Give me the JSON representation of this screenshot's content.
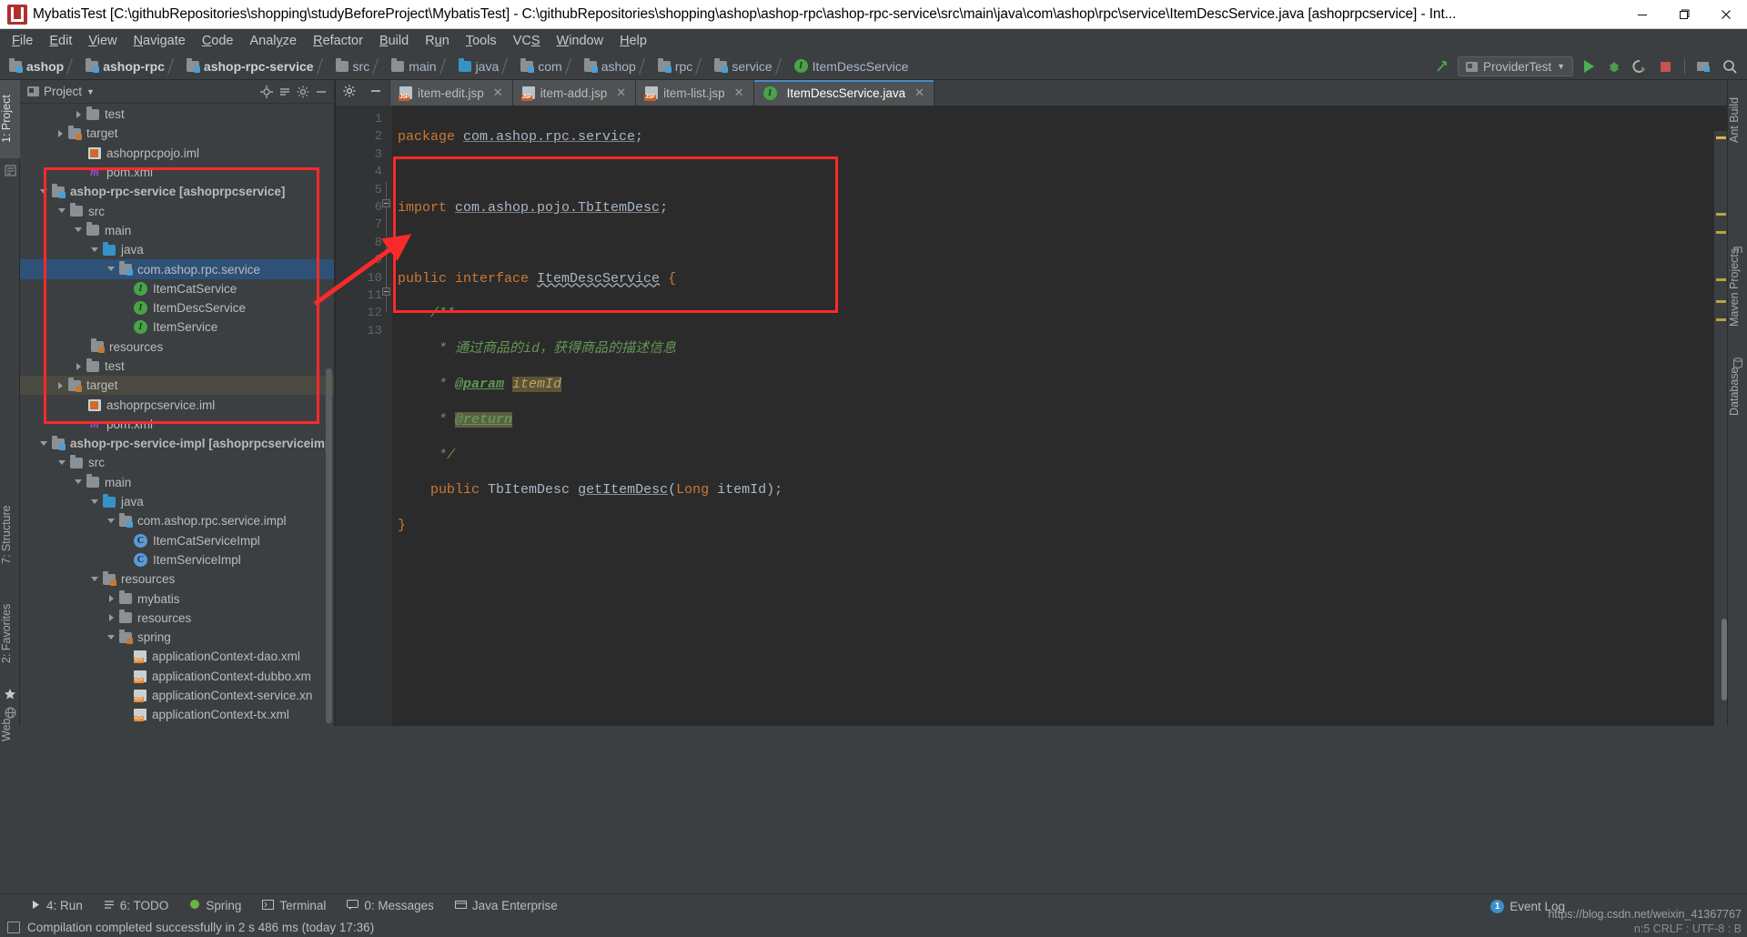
{
  "window": {
    "title": "MybatisTest [C:\\githubRepositories\\shopping\\studyBeforeProject\\MybatisTest] - C:\\githubRepositories\\shopping\\ashop\\ashop-rpc\\ashop-rpc-service\\src\\main\\java\\com\\ashop\\rpc\\service\\ItemDescService.java [ashoprpcservice] - Int...",
    "minimize": "—",
    "maximize": "❐",
    "close": "✕"
  },
  "menu": [
    {
      "label": "File"
    },
    {
      "label": "Edit"
    },
    {
      "label": "View"
    },
    {
      "label": "Navigate"
    },
    {
      "label": "Code"
    },
    {
      "label": "Analyze"
    },
    {
      "label": "Refactor"
    },
    {
      "label": "Build"
    },
    {
      "label": "Run"
    },
    {
      "label": "Tools"
    },
    {
      "label": "VCS"
    },
    {
      "label": "Window"
    },
    {
      "label": "Help"
    }
  ],
  "breadcrumb": [
    {
      "label": "ashop",
      "icon": "module-folder-icon",
      "bold": true
    },
    {
      "label": "ashop-rpc",
      "icon": "module-folder-icon",
      "bold": true
    },
    {
      "label": "ashop-rpc-service",
      "icon": "module-folder-icon",
      "bold": true
    },
    {
      "label": "src",
      "icon": "folder-icon",
      "bold": false
    },
    {
      "label": "main",
      "icon": "folder-icon",
      "bold": false
    },
    {
      "label": "java",
      "icon": "source-folder-icon",
      "bold": false
    },
    {
      "label": "com",
      "icon": "package-icon",
      "bold": false
    },
    {
      "label": "ashop",
      "icon": "package-icon",
      "bold": false
    },
    {
      "label": "rpc",
      "icon": "package-icon",
      "bold": false
    },
    {
      "label": "service",
      "icon": "package-icon",
      "bold": false
    },
    {
      "label": "ItemDescService",
      "icon": "interface-icon",
      "bold": false
    }
  ],
  "toolbar_right": {
    "run_config": "ProviderTest",
    "icons": [
      "build-icon",
      "run-icon",
      "debug-icon",
      "coverage-icon",
      "stop-icon",
      "project-structure-icon",
      "search-icon"
    ]
  },
  "project_panel": {
    "title": "Project",
    "header_icons": [
      "locate-icon",
      "collapse-all-icon",
      "settings-icon",
      "hide-icon"
    ],
    "tree": [
      {
        "label": "test",
        "indent": 3,
        "icon": "folder",
        "arrow": "closed"
      },
      {
        "label": "target",
        "indent": 2,
        "icon": "folder-orange",
        "arrow": "closed"
      },
      {
        "label": "ashoprpcpojo.iml",
        "indent": 3,
        "icon": "iml",
        "arrow": "none"
      },
      {
        "label": "pom.xml",
        "indent": 3,
        "icon": "maven",
        "arrow": "none"
      },
      {
        "label": "ashop-rpc-service [ashoprpcservice]",
        "indent": 1,
        "icon": "module",
        "arrow": "open",
        "bold": true
      },
      {
        "label": "src",
        "indent": 2,
        "icon": "folder",
        "arrow": "open"
      },
      {
        "label": "main",
        "indent": 3,
        "icon": "folder",
        "arrow": "open"
      },
      {
        "label": "java",
        "indent": 4,
        "icon": "source-folder",
        "arrow": "open"
      },
      {
        "label": "com.ashop.rpc.service",
        "indent": 5,
        "icon": "package",
        "arrow": "open",
        "selected": true
      },
      {
        "label": "ItemCatService",
        "indent": 6,
        "icon": "interface",
        "arrow": "none"
      },
      {
        "label": "ItemDescService",
        "indent": 6,
        "icon": "interface",
        "arrow": "none"
      },
      {
        "label": "ItemService",
        "indent": 6,
        "icon": "interface",
        "arrow": "none"
      },
      {
        "label": "resources",
        "indent": 4,
        "icon": "resources-folder",
        "arrow": "none"
      },
      {
        "label": "test",
        "indent": 3,
        "icon": "folder",
        "arrow": "closed"
      },
      {
        "label": "target",
        "indent": 2,
        "icon": "folder-orange",
        "arrow": "closed",
        "highlight": true
      },
      {
        "label": "ashoprpcservice.iml",
        "indent": 3,
        "icon": "iml",
        "arrow": "none"
      },
      {
        "label": "pom.xml",
        "indent": 3,
        "icon": "maven",
        "arrow": "none"
      },
      {
        "label": "ashop-rpc-service-impl [ashoprpcserviceimp",
        "indent": 1,
        "icon": "module",
        "arrow": "open",
        "bold": true
      },
      {
        "label": "src",
        "indent": 2,
        "icon": "folder",
        "arrow": "open"
      },
      {
        "label": "main",
        "indent": 3,
        "icon": "folder",
        "arrow": "open"
      },
      {
        "label": "java",
        "indent": 4,
        "icon": "source-folder",
        "arrow": "open"
      },
      {
        "label": "com.ashop.rpc.service.impl",
        "indent": 5,
        "icon": "package",
        "arrow": "open"
      },
      {
        "label": "ItemCatServiceImpl",
        "indent": 6,
        "icon": "class",
        "arrow": "none"
      },
      {
        "label": "ItemServiceImpl",
        "indent": 6,
        "icon": "class",
        "arrow": "none"
      },
      {
        "label": "resources",
        "indent": 4,
        "icon": "resources-folder",
        "arrow": "open"
      },
      {
        "label": "mybatis",
        "indent": 5,
        "icon": "folder",
        "arrow": "closed"
      },
      {
        "label": "resources",
        "indent": 5,
        "icon": "folder",
        "arrow": "closed"
      },
      {
        "label": "spring",
        "indent": 5,
        "icon": "resources-folder",
        "arrow": "open"
      },
      {
        "label": "applicationContext-dao.xml",
        "indent": 6,
        "icon": "xml",
        "arrow": "none"
      },
      {
        "label": "applicationContext-dubbo.xm",
        "indent": 6,
        "icon": "xml",
        "arrow": "none"
      },
      {
        "label": "applicationContext-service.xn",
        "indent": 6,
        "icon": "xml",
        "arrow": "none"
      },
      {
        "label": "applicationContext-tx.xml",
        "indent": 6,
        "icon": "xml",
        "arrow": "none"
      }
    ]
  },
  "left_strip": [
    {
      "label": "1: Project",
      "selected": true
    },
    {
      "label": "7: Structure",
      "selected": false
    },
    {
      "label": "2: Favorites",
      "selected": false
    },
    {
      "label": "Web",
      "selected": false
    }
  ],
  "right_strip": [
    {
      "label": "Ant Build"
    },
    {
      "label": "Maven Projects"
    },
    {
      "label": "Database"
    }
  ],
  "editor": {
    "tabs": [
      {
        "label": "item-edit.jsp",
        "icon": "jsp-file-icon",
        "active": false
      },
      {
        "label": "item-add.jsp",
        "icon": "jsp-file-icon",
        "active": false
      },
      {
        "label": "item-list.jsp",
        "icon": "jsp-file-icon",
        "active": false
      },
      {
        "label": "ItemDescService.java",
        "icon": "interface-icon",
        "active": true
      }
    ],
    "close_glyph": "✕",
    "line_numbers": [
      "1",
      "2",
      "3",
      "4",
      "5",
      "6",
      "7",
      "8",
      "9",
      "10",
      "11",
      "12",
      "13"
    ],
    "lines": [
      {
        "n": 1,
        "tokens": [
          {
            "t": "package ",
            "c": "kw"
          },
          {
            "t": "com.ashop.rpc.service",
            "c": "cls"
          },
          {
            "t": ";",
            "c": "plain"
          }
        ]
      },
      {
        "n": 2,
        "tokens": []
      },
      {
        "n": 3,
        "tokens": [
          {
            "t": "import ",
            "c": "kw"
          },
          {
            "t": "com.ashop.pojo.TbItemDesc",
            "c": "cls"
          },
          {
            "t": ";",
            "c": "plain"
          }
        ]
      },
      {
        "n": 4,
        "tokens": []
      },
      {
        "n": 5,
        "tokens": [
          {
            "t": "public ",
            "c": "kw"
          },
          {
            "t": "interface ",
            "c": "kw"
          },
          {
            "t": "ItemDescService",
            "c": "wavy"
          },
          {
            "t": " {",
            "c": "brace"
          }
        ]
      },
      {
        "n": 6,
        "tokens": [
          {
            "t": "    /**",
            "c": "cmt"
          }
        ]
      },
      {
        "n": 7,
        "tokens": [
          {
            "t": "     * ",
            "c": "cmt"
          },
          {
            "t": "通过商品的id，获得商品的描述信息",
            "c": "cmt"
          }
        ]
      },
      {
        "n": 8,
        "tokens": [
          {
            "t": "     * ",
            "c": "cmt"
          },
          {
            "t": "@param",
            "c": "tag"
          },
          {
            "t": " ",
            "c": "cmt"
          },
          {
            "t": "itemId",
            "c": "prm"
          }
        ]
      },
      {
        "n": 9,
        "tokens": [
          {
            "t": "     * ",
            "c": "cmt"
          },
          {
            "t": "@return",
            "c": "tagh"
          }
        ]
      },
      {
        "n": 10,
        "tokens": [
          {
            "t": "     */",
            "c": "cmt"
          }
        ]
      },
      {
        "n": 11,
        "tokens": [
          {
            "t": "    public ",
            "c": "kw"
          },
          {
            "t": "TbItemDesc ",
            "c": "plain"
          },
          {
            "t": "getItemDesc",
            "c": "mth"
          },
          {
            "t": "(",
            "c": "plain"
          },
          {
            "t": "Long",
            "c": "kw"
          },
          {
            "t": " itemId);",
            "c": "plain"
          }
        ]
      },
      {
        "n": 12,
        "tokens": [
          {
            "t": "}",
            "c": "brace"
          }
        ]
      },
      {
        "n": 13,
        "tokens": []
      }
    ]
  },
  "annotations": {
    "sidebar_box": "red-rectangle-sidebar",
    "code_box": "red-rectangle-code",
    "arrow": "red-arrow"
  },
  "bottom_bar": [
    {
      "label": "4: Run",
      "icon": "run-icon"
    },
    {
      "label": "6: TODO",
      "icon": "todo-icon"
    },
    {
      "label": "Spring",
      "icon": "spring-icon"
    },
    {
      "label": "Terminal",
      "icon": "terminal-icon"
    },
    {
      "label": "0: Messages",
      "icon": "messages-icon"
    },
    {
      "label": "Java Enterprise",
      "icon": "java-ee-icon"
    }
  ],
  "event_log": {
    "label": "Event Log",
    "count": "1"
  },
  "status_bar": {
    "message": "Compilation completed successfully in 2 s 486 ms (today 17:36)",
    "right_info": "n:5  CRLF :  UTF-8 :  В"
  },
  "watermark": "https://blog.csdn.net/weixin_41367767",
  "colors": {
    "accent": "#4a88c7",
    "annotation_red": "#fb2a2a",
    "selection": "#2d5177",
    "editor_bg": "#2b2b2b",
    "panel_bg": "#3c3f41",
    "keyword": "#cc7832",
    "comment": "#629755"
  }
}
